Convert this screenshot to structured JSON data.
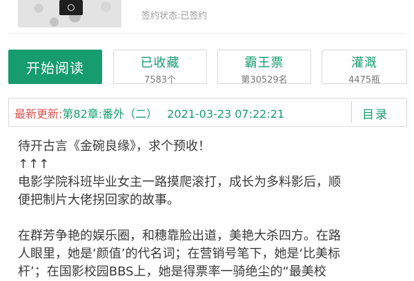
{
  "book": {
    "contract_status": "签约状态:已签约"
  },
  "actions": {
    "read_label": "开始阅读",
    "collect": {
      "title": "已收藏",
      "sub": "7583个"
    },
    "monthly_ticket": {
      "title": "霸王票",
      "sub": "第30529名"
    },
    "water": {
      "title": "灌溉",
      "sub": "4475瓶"
    }
  },
  "update": {
    "label": "最新更新:",
    "chapter": "第82章:番外（二）",
    "time": "2021-03-23 07:22:21",
    "catalog_label": "目录"
  },
  "description": {
    "lines": [
      "待开古言《金碗良缘》，求个预收！",
      "↑↑↑",
      "电影学院科班毕业女主一路摸爬滚打，成长为多料影后，顺",
      "便把制片大佬拐回家的故事。",
      "",
      "在群芳争艳的娱乐圈，和穗靠脸出道，美艳大杀四方。在路",
      "人眼里，她是‘颜值’的代名词；在营销号笔下，她是‘比美标",
      "杆’；在国影校园BBS上，她是得票率一骑绝尘的“最美校"
    ]
  },
  "colors": {
    "accent": "#169c6e",
    "update_label": "#d9534f"
  }
}
